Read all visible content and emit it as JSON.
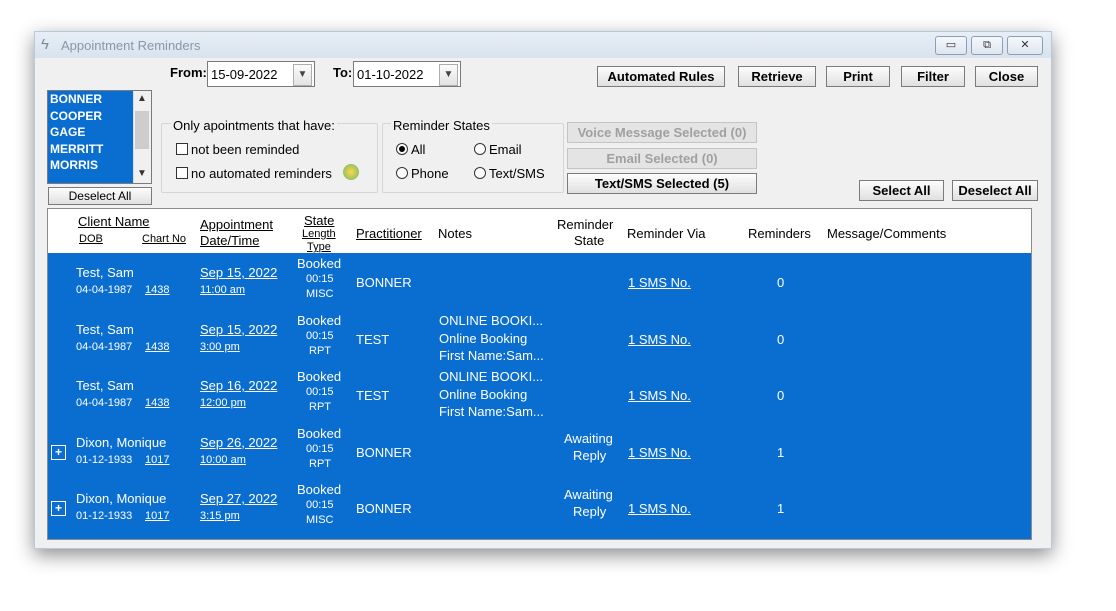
{
  "window": {
    "title": "Appointment Reminders",
    "controls": {
      "minimize": "▭",
      "restore": "⧉",
      "close": "✕"
    }
  },
  "dates": {
    "from_label": "From:",
    "from_value": "15-09-2022",
    "to_label": "To:",
    "to_value": "01-10-2022"
  },
  "toolbar": {
    "automated_rules": "Automated Rules",
    "retrieve": "Retrieve",
    "print": "Print",
    "filter": "Filter",
    "close": "Close"
  },
  "practitioners": {
    "items": [
      "BONNER",
      "COOPER",
      "GAGE",
      "MERRITT",
      "MORRIS"
    ],
    "deselect_all": "Deselect All"
  },
  "only_appointments": {
    "title": "Only apointments that have:",
    "not_reminded": "not been reminded",
    "no_automated": "no automated reminders"
  },
  "reminder_states": {
    "title": "Reminder States",
    "all": "All",
    "email": "Email",
    "phone": "Phone",
    "text_sms": "Text/SMS",
    "selected": "All"
  },
  "actions": {
    "voice": "Voice Message Selected (0)",
    "email": "Email Selected (0)",
    "sms": "Text/SMS Selected (5)",
    "select_all": "Select All",
    "deselect_all": "Deselect All"
  },
  "columns": {
    "client_name": "Client Name",
    "dob": "DOB",
    "chart_no": "Chart No",
    "appointment": "Appointment",
    "date_time": "Date/Time",
    "state": "State",
    "length": "Length",
    "type": "Type",
    "practitioner": "Practitioner",
    "notes": "Notes",
    "reminder": "Reminder",
    "reminder_state": "State",
    "reminder_via": "Reminder Via",
    "reminders": "Reminders",
    "message": "Message/Comments"
  },
  "rows": [
    {
      "expand": "",
      "name": "Test, Sam",
      "dob": "04-04-1987",
      "chart": "1438",
      "date": "Sep 15, 2022",
      "time": "11:00 am",
      "state": "Booked",
      "length": "00:15",
      "type": "MISC",
      "practitioner": "BONNER",
      "notes": [
        "",
        "",
        ""
      ],
      "rstate1": "",
      "rstate2": "",
      "via": "1 SMS No.",
      "reminders": "0"
    },
    {
      "expand": "",
      "name": "Test, Sam",
      "dob": "04-04-1987",
      "chart": "1438",
      "date": "Sep 15, 2022",
      "time": "3:00 pm",
      "state": "Booked",
      "length": "00:15",
      "type": "RPT",
      "practitioner": "TEST",
      "notes": [
        "ONLINE BOOKI...",
        "Online Booking",
        "First Name:Sam..."
      ],
      "rstate1": "",
      "rstate2": "",
      "via": "1 SMS No.",
      "reminders": "0"
    },
    {
      "expand": "",
      "name": "Test, Sam",
      "dob": "04-04-1987",
      "chart": "1438",
      "date": "Sep 16, 2022",
      "time": "12:00 pm",
      "state": "Booked",
      "length": "00:15",
      "type": "RPT",
      "practitioner": "TEST",
      "notes": [
        "ONLINE BOOKI...",
        "Online Booking",
        "First Name:Sam..."
      ],
      "rstate1": "",
      "rstate2": "",
      "via": "1 SMS No.",
      "reminders": "0"
    },
    {
      "expand": "+",
      "name": "Dixon, Monique",
      "dob": "01-12-1933",
      "chart": "1017",
      "date": "Sep 26, 2022",
      "time": "10:00 am",
      "state": "Booked",
      "length": "00:15",
      "type": "RPT",
      "practitioner": "BONNER",
      "notes": [
        "",
        "",
        ""
      ],
      "rstate1": "Awaiting",
      "rstate2": "Reply",
      "via": "1 SMS No.",
      "reminders": "1"
    },
    {
      "expand": "+",
      "name": "Dixon, Monique",
      "dob": "01-12-1933",
      "chart": "1017",
      "date": "Sep 27, 2022",
      "time": "3:15 pm",
      "state": "Booked",
      "length": "00:15",
      "type": "MISC",
      "practitioner": "BONNER",
      "notes": [
        "",
        "",
        ""
      ],
      "rstate1": "Awaiting",
      "rstate2": "Reply",
      "via": "1 SMS No.",
      "reminders": "1"
    }
  ]
}
